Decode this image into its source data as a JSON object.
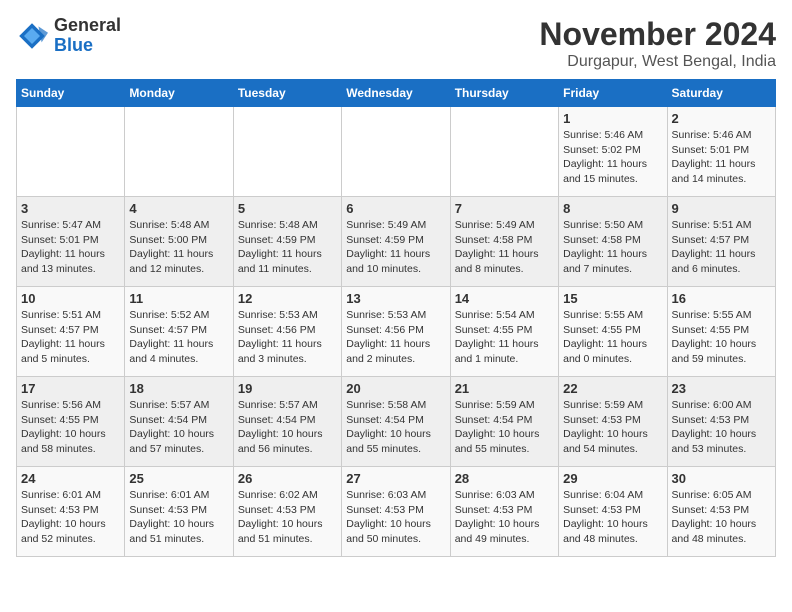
{
  "logo": {
    "text_general": "General",
    "text_blue": "Blue"
  },
  "title": "November 2024",
  "location": "Durgapur, West Bengal, India",
  "days_of_week": [
    "Sunday",
    "Monday",
    "Tuesday",
    "Wednesday",
    "Thursday",
    "Friday",
    "Saturday"
  ],
  "weeks": [
    [
      {
        "day": "",
        "detail": ""
      },
      {
        "day": "",
        "detail": ""
      },
      {
        "day": "",
        "detail": ""
      },
      {
        "day": "",
        "detail": ""
      },
      {
        "day": "",
        "detail": ""
      },
      {
        "day": "1",
        "detail": "Sunrise: 5:46 AM\nSunset: 5:02 PM\nDaylight: 11 hours and 15 minutes."
      },
      {
        "day": "2",
        "detail": "Sunrise: 5:46 AM\nSunset: 5:01 PM\nDaylight: 11 hours and 14 minutes."
      }
    ],
    [
      {
        "day": "3",
        "detail": "Sunrise: 5:47 AM\nSunset: 5:01 PM\nDaylight: 11 hours and 13 minutes."
      },
      {
        "day": "4",
        "detail": "Sunrise: 5:48 AM\nSunset: 5:00 PM\nDaylight: 11 hours and 12 minutes."
      },
      {
        "day": "5",
        "detail": "Sunrise: 5:48 AM\nSunset: 4:59 PM\nDaylight: 11 hours and 11 minutes."
      },
      {
        "day": "6",
        "detail": "Sunrise: 5:49 AM\nSunset: 4:59 PM\nDaylight: 11 hours and 10 minutes."
      },
      {
        "day": "7",
        "detail": "Sunrise: 5:49 AM\nSunset: 4:58 PM\nDaylight: 11 hours and 8 minutes."
      },
      {
        "day": "8",
        "detail": "Sunrise: 5:50 AM\nSunset: 4:58 PM\nDaylight: 11 hours and 7 minutes."
      },
      {
        "day": "9",
        "detail": "Sunrise: 5:51 AM\nSunset: 4:57 PM\nDaylight: 11 hours and 6 minutes."
      }
    ],
    [
      {
        "day": "10",
        "detail": "Sunrise: 5:51 AM\nSunset: 4:57 PM\nDaylight: 11 hours and 5 minutes."
      },
      {
        "day": "11",
        "detail": "Sunrise: 5:52 AM\nSunset: 4:57 PM\nDaylight: 11 hours and 4 minutes."
      },
      {
        "day": "12",
        "detail": "Sunrise: 5:53 AM\nSunset: 4:56 PM\nDaylight: 11 hours and 3 minutes."
      },
      {
        "day": "13",
        "detail": "Sunrise: 5:53 AM\nSunset: 4:56 PM\nDaylight: 11 hours and 2 minutes."
      },
      {
        "day": "14",
        "detail": "Sunrise: 5:54 AM\nSunset: 4:55 PM\nDaylight: 11 hours and 1 minute."
      },
      {
        "day": "15",
        "detail": "Sunrise: 5:55 AM\nSunset: 4:55 PM\nDaylight: 11 hours and 0 minutes."
      },
      {
        "day": "16",
        "detail": "Sunrise: 5:55 AM\nSunset: 4:55 PM\nDaylight: 10 hours and 59 minutes."
      }
    ],
    [
      {
        "day": "17",
        "detail": "Sunrise: 5:56 AM\nSunset: 4:55 PM\nDaylight: 10 hours and 58 minutes."
      },
      {
        "day": "18",
        "detail": "Sunrise: 5:57 AM\nSunset: 4:54 PM\nDaylight: 10 hours and 57 minutes."
      },
      {
        "day": "19",
        "detail": "Sunrise: 5:57 AM\nSunset: 4:54 PM\nDaylight: 10 hours and 56 minutes."
      },
      {
        "day": "20",
        "detail": "Sunrise: 5:58 AM\nSunset: 4:54 PM\nDaylight: 10 hours and 55 minutes."
      },
      {
        "day": "21",
        "detail": "Sunrise: 5:59 AM\nSunset: 4:54 PM\nDaylight: 10 hours and 55 minutes."
      },
      {
        "day": "22",
        "detail": "Sunrise: 5:59 AM\nSunset: 4:53 PM\nDaylight: 10 hours and 54 minutes."
      },
      {
        "day": "23",
        "detail": "Sunrise: 6:00 AM\nSunset: 4:53 PM\nDaylight: 10 hours and 53 minutes."
      }
    ],
    [
      {
        "day": "24",
        "detail": "Sunrise: 6:01 AM\nSunset: 4:53 PM\nDaylight: 10 hours and 52 minutes."
      },
      {
        "day": "25",
        "detail": "Sunrise: 6:01 AM\nSunset: 4:53 PM\nDaylight: 10 hours and 51 minutes."
      },
      {
        "day": "26",
        "detail": "Sunrise: 6:02 AM\nSunset: 4:53 PM\nDaylight: 10 hours and 51 minutes."
      },
      {
        "day": "27",
        "detail": "Sunrise: 6:03 AM\nSunset: 4:53 PM\nDaylight: 10 hours and 50 minutes."
      },
      {
        "day": "28",
        "detail": "Sunrise: 6:03 AM\nSunset: 4:53 PM\nDaylight: 10 hours and 49 minutes."
      },
      {
        "day": "29",
        "detail": "Sunrise: 6:04 AM\nSunset: 4:53 PM\nDaylight: 10 hours and 48 minutes."
      },
      {
        "day": "30",
        "detail": "Sunrise: 6:05 AM\nSunset: 4:53 PM\nDaylight: 10 hours and 48 minutes."
      }
    ]
  ]
}
